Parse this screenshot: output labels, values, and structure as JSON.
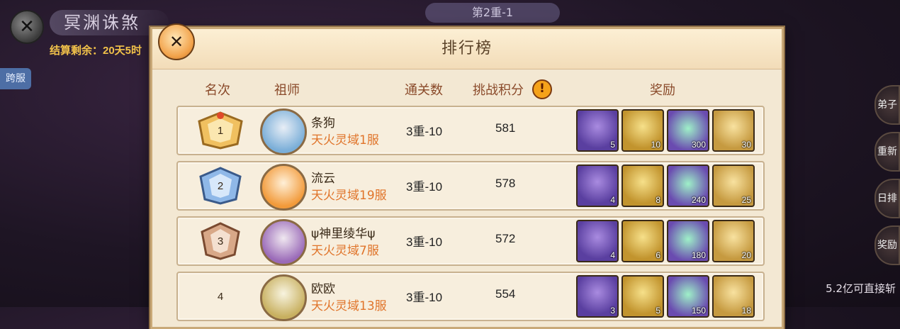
{
  "background": {
    "mode_title": "冥渊诛煞",
    "settle_text": "结算剩余：20天5时",
    "cross_server_tab": "跨服",
    "stage_label": "第2重-1",
    "right_buttons": [
      "弟子",
      "重新",
      "日排",
      "奖励"
    ],
    "bottom_note": "5.2亿可直接斩"
  },
  "panel": {
    "title": "排行榜",
    "columns": {
      "rank": "名次",
      "master": "祖师",
      "clears": "通关数",
      "score": "挑战积分",
      "rewards": "奖励"
    },
    "rows": [
      {
        "rank": "1",
        "badge": "gold",
        "name": "条狗",
        "server": "天火灵域1服",
        "clears": "3重-10",
        "score": "581",
        "rewards": [
          "5",
          "10",
          "300",
          "30"
        ]
      },
      {
        "rank": "2",
        "badge": "blue",
        "name": "流云",
        "server": "天火灵域19服",
        "clears": "3重-10",
        "score": "578",
        "rewards": [
          "4",
          "8",
          "240",
          "25"
        ]
      },
      {
        "rank": "3",
        "badge": "bronze",
        "name": "ψ神里绫华ψ",
        "server": "天火灵域7服",
        "clears": "3重-10",
        "score": "572",
        "rewards": [
          "4",
          "6",
          "180",
          "20"
        ]
      },
      {
        "rank": "4",
        "badge": "none",
        "name": "欧欧",
        "server": "天火灵域13服",
        "clears": "3重-10",
        "score": "554",
        "rewards": [
          "3",
          "5",
          "150",
          "18"
        ]
      }
    ]
  }
}
